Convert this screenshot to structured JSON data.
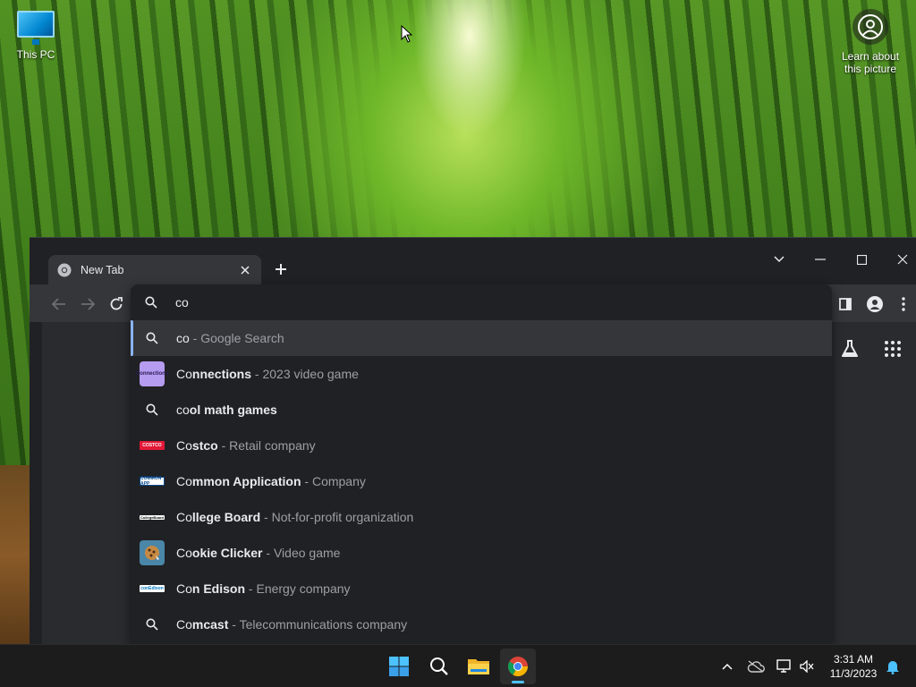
{
  "desktop": {
    "icons": [
      {
        "label": "This PC",
        "icon": "monitor-icon"
      }
    ],
    "learn_about_picture": {
      "line1": "Learn about",
      "line2": "this picture",
      "icon": "camera-circle-icon"
    }
  },
  "browser": {
    "tab": {
      "title": "New Tab",
      "icon": "chrome-icon"
    },
    "omnibox": {
      "value": "co",
      "suggestions": [
        {
          "bold": "",
          "plain_prefix": "co",
          "rest_bold": "",
          "rest": "",
          "sep": " - ",
          "desc": "Google Search",
          "icon": "search-icon"
        },
        {
          "bold": "Co",
          "rest_bold": "nnections",
          "sep": " - ",
          "desc": "2023 video game",
          "icon": "connections-thumb",
          "thumb_text": "Connections"
        },
        {
          "bold": "co",
          "rest_bold": "ol math games",
          "sep": "",
          "desc": "",
          "icon": "search-icon"
        },
        {
          "bold": "Co",
          "rest_bold": "stco",
          "sep": " - ",
          "desc": "Retail company",
          "icon": "costco-logo",
          "thumb_text": "COSTCO"
        },
        {
          "bold": "Co",
          "rest_bold": "mmon Application",
          "sep": " - ",
          "desc": "Company",
          "icon": "common-app-logo",
          "thumb_text": "COMMON APP"
        },
        {
          "bold": "Co",
          "rest_bold": "llege Board",
          "sep": " - ",
          "desc": "Not-for-profit organization",
          "icon": "college-board-logo",
          "thumb_text": "CollegeBoard"
        },
        {
          "bold": "Co",
          "rest_bold": "okie Clicker",
          "sep": " - ",
          "desc": "Video game",
          "icon": "cookie-thumb"
        },
        {
          "bold": "Co",
          "rest_bold": "n Edison",
          "sep": " - ",
          "desc": "Energy company",
          "icon": "con-edison-logo",
          "thumb_text": "conEdison"
        },
        {
          "bold": "Co",
          "rest_bold": "mcast",
          "sep": " - ",
          "desc": "Telecommunications company",
          "icon": "search-icon"
        }
      ]
    }
  },
  "taskbar": {
    "apps": [
      "windows-start-icon",
      "search-icon",
      "file-explorer-icon",
      "chrome-icon"
    ],
    "clock": {
      "time": "3:31 AM",
      "date": "11/3/2023"
    }
  },
  "colors": {
    "accent": "#8ab4f8",
    "taskbar_accent": "#4cc2ff",
    "chrome_bg": "#202124",
    "toolbar_bg": "#35363a"
  }
}
